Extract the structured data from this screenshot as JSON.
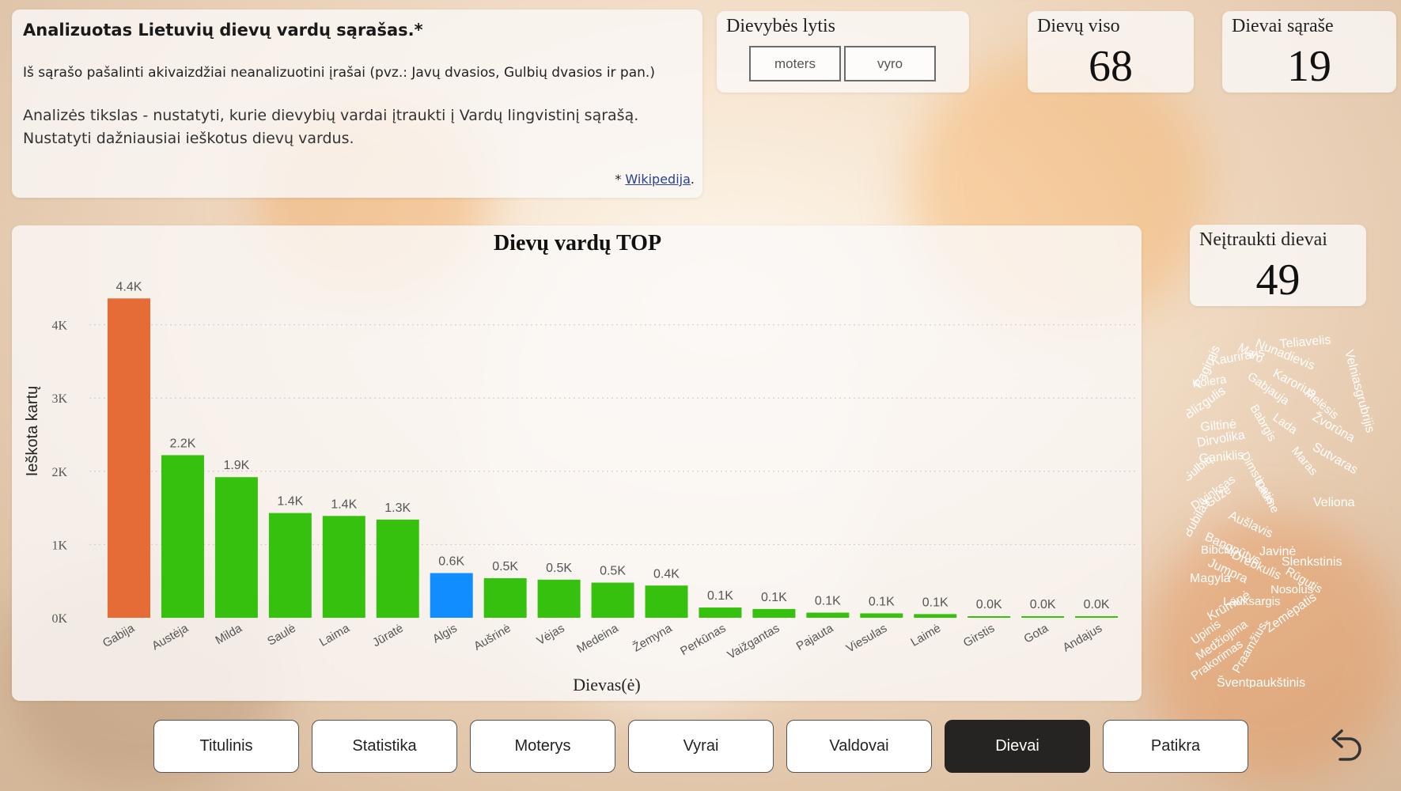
{
  "info": {
    "title": "Analizuotas Lietuvių dievų vardų sąrašas.*",
    "note": "Iš sąrašo pašalinti akivaizdžiai neanalizuotini įrašai (pvz.: Javų dvasios, Gulbių dvasios ir pan.)",
    "goal_line1": "Analizės tikslas - nustatyti, kurie dievybių vardai įtraukti į Vardų lingvistinį sąrašą.",
    "goal_line2": "Nustatyti dažniausiai ieškotus dievų vardus.",
    "source_prefix": "* ",
    "source_link": "Wikipedija",
    "source_suffix": "."
  },
  "gender_slicer": {
    "title": "Dievybės lytis",
    "options": [
      "moters",
      "vyro"
    ]
  },
  "kpis": {
    "total_label": "Dievų viso",
    "total_value": "68",
    "in_list_label": "Dievai sąraše",
    "in_list_value": "19",
    "excluded_label": "Neįtraukti dievai",
    "excluded_value": "49"
  },
  "chart_data": {
    "type": "bar",
    "title": "Dievų vardų TOP",
    "xlabel": "Dievas(ė)",
    "ylabel": "Ieškota kartų",
    "ylim": [
      0,
      4400
    ],
    "yticks": [
      0,
      1000,
      2000,
      3000,
      4000
    ],
    "ytick_labels": [
      "0K",
      "1K",
      "2K",
      "3K",
      "4K"
    ],
    "grid": true,
    "categories": [
      "Gabija",
      "Austėja",
      "Milda",
      "Saulė",
      "Laima",
      "Jūratė",
      "Algis",
      "Aušrinė",
      "Vėjas",
      "Medeina",
      "Žemyna",
      "Perkūnas",
      "Vaižgantas",
      "Pajauta",
      "Viesulas",
      "Laimė",
      "Girstis",
      "Gota",
      "Andajus"
    ],
    "values": [
      4360,
      2220,
      1920,
      1430,
      1390,
      1340,
      610,
      540,
      520,
      480,
      440,
      140,
      120,
      70,
      60,
      50,
      20,
      15,
      10
    ],
    "data_labels": [
      "4.4K",
      "2.2K",
      "1.9K",
      "1.4K",
      "1.4K",
      "1.3K",
      "0.6K",
      "0.5K",
      "0.5K",
      "0.5K",
      "0.4K",
      "0.1K",
      "0.1K",
      "0.1K",
      "0.1K",
      "0.1K",
      "0.0K",
      "0.0K",
      "0.0K"
    ],
    "bar_colors": [
      "#E66C37",
      "#37C10F",
      "#37C10F",
      "#37C10F",
      "#37C10F",
      "#37C10F",
      "#118DFF",
      "#37C10F",
      "#37C10F",
      "#37C10F",
      "#37C10F",
      "#37C10F",
      "#37C10F",
      "#37C10F",
      "#37C10F",
      "#37C10F",
      "#37C10F",
      "#37C10F",
      "#37C10F"
    ]
  },
  "word_cloud": [
    "Pagirnis",
    "Maro",
    "Nunadievis",
    "Teliavelis",
    "Kauriraris",
    "Kolera",
    "Velniasgrubrijis",
    "Karorius",
    "Blizgulis",
    "Gabjauja",
    "Melėsis",
    "Žvorūna",
    "Giltinė",
    "Dirvolika",
    "Lada",
    "Ganiklis",
    "Babrgis",
    "Sutvaras",
    "Gulbių",
    "Maras",
    "Divinksas",
    "Dimstipatis",
    "Veliona",
    "Bubilas",
    "Guže",
    "Aušlavis",
    "Laume",
    "Bangpūtys",
    "Bibčių",
    "Javinė",
    "Slenkstinis",
    "Magyla",
    "Jumpra",
    "Rūgutis",
    "Drebkulis",
    "Krūminė",
    "Nosolus",
    "Lauksargis",
    "Upinis",
    "Medžiojima",
    "Žemėpatis",
    "Prakorimas",
    "Praamžius",
    "Šventpaukštinis"
  ],
  "nav": {
    "buttons": [
      "Titulinis",
      "Statistika",
      "Moterys",
      "Vyrai",
      "Valdovai",
      "Dievai",
      "Patikra"
    ],
    "active": "Dievai",
    "back_icon": "undo-arrow-icon"
  },
  "colors": {
    "bar_default": "#37C10F",
    "bar_top": "#E66C37",
    "bar_highlight": "#118DFF",
    "nav_active": "#252423"
  }
}
